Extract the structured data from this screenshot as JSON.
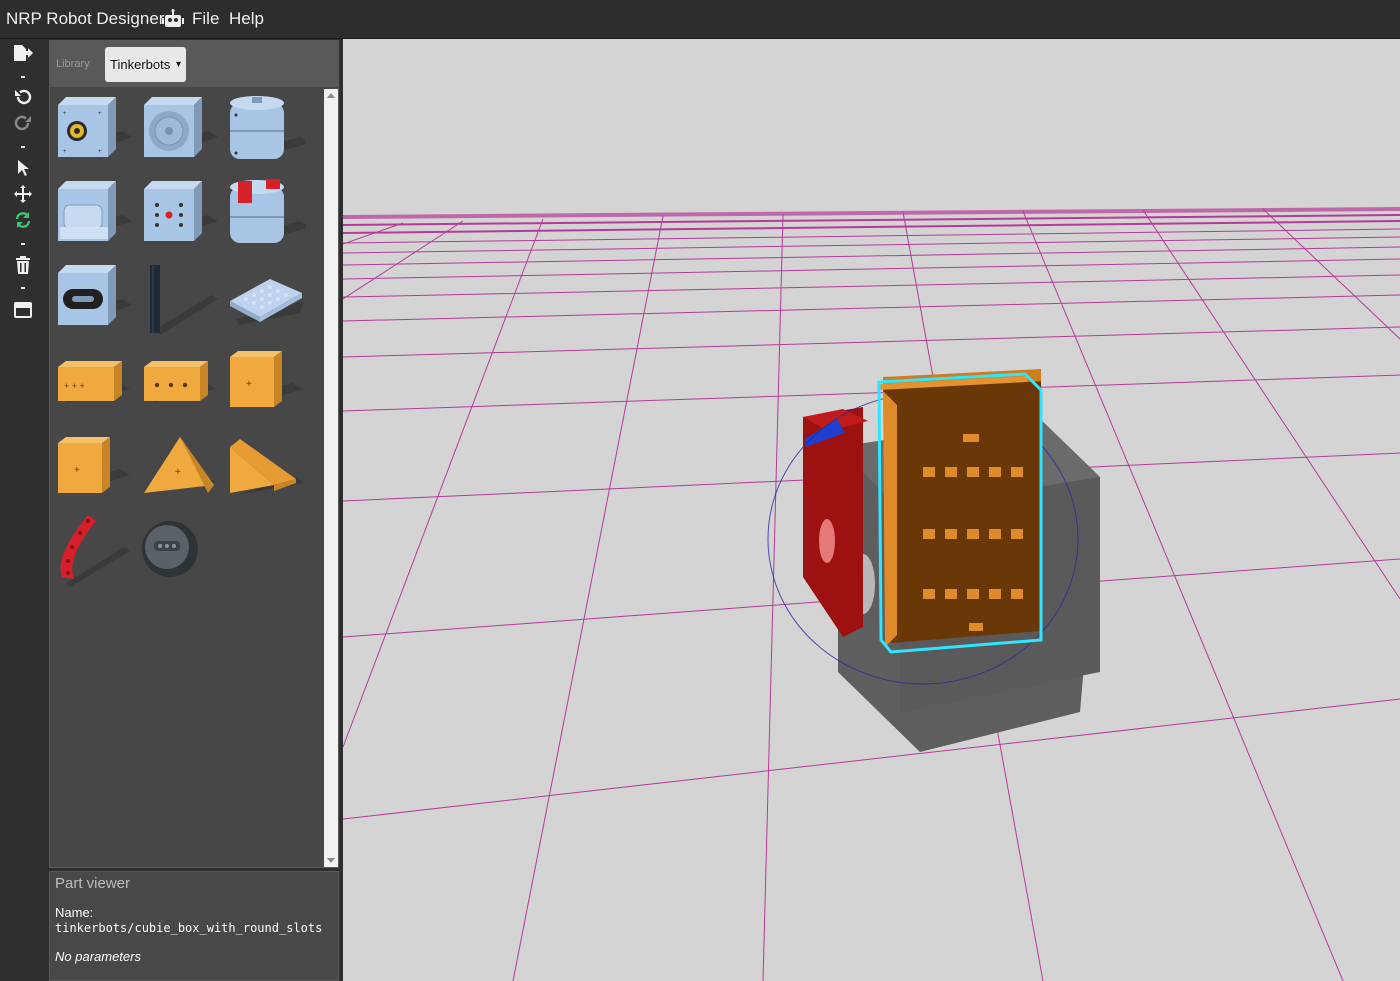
{
  "app": {
    "title": "NRP Robot Designer",
    "menu": [
      "File",
      "Help"
    ]
  },
  "toolbar": {
    "tools": [
      {
        "name": "export-icon"
      },
      {
        "name": "undo-icon"
      },
      {
        "name": "redo-icon"
      },
      {
        "name": "select-pointer-icon"
      },
      {
        "name": "move-icon"
      },
      {
        "name": "rotate-icon",
        "active": true
      },
      {
        "name": "delete-icon"
      },
      {
        "name": "window-icon"
      }
    ]
  },
  "library": {
    "label": "Library",
    "selected": "Tinkerbots",
    "caret": "▾",
    "parts": [
      {
        "name": "part-motor-cube-blue",
        "color": "#a9c5e6"
      },
      {
        "name": "part-servo-cube-blue",
        "color": "#a9c5e6"
      },
      {
        "name": "part-cylinder-blue",
        "color": "#a9c5e6"
      },
      {
        "name": "part-hinge-cube-blue",
        "color": "#a9c5e6"
      },
      {
        "name": "part-sensor-cube-blue",
        "color": "#a9c5e6"
      },
      {
        "name": "part-gripper-cylinder-blue",
        "color": "#a9c5e6"
      },
      {
        "name": "part-switch-cube-blue",
        "color": "#a9c5e6"
      },
      {
        "name": "part-axle-black",
        "color": "#1f2a36"
      },
      {
        "name": "part-plate-blue",
        "color": "#bcd2ee"
      },
      {
        "name": "part-brick-orange-1",
        "color": "#f0a93e"
      },
      {
        "name": "part-brick-orange-2",
        "color": "#f0a93e"
      },
      {
        "name": "part-cube-orange",
        "color": "#f0a93e"
      },
      {
        "name": "part-cube-orange-2",
        "color": "#f0a93e"
      },
      {
        "name": "part-pyramid-orange",
        "color": "#f0a93e"
      },
      {
        "name": "part-wedge-orange",
        "color": "#f0a93e"
      },
      {
        "name": "part-arm-red",
        "color": "#d8202a"
      },
      {
        "name": "part-wheel-grey",
        "color": "#5a6168"
      }
    ]
  },
  "part_viewer": {
    "title": "Part viewer",
    "name_label": "Name:",
    "name_value": "tinkerbots/cubie_box_with_round_slots",
    "params": "No parameters"
  },
  "colors": {
    "grid": "#b0208f",
    "scene_bg": "#d4d4d4",
    "selection": "#2ee6ff",
    "active_tool": "#37c871"
  }
}
